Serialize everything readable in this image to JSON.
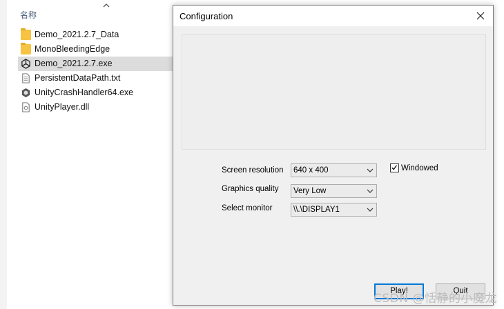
{
  "explorer": {
    "column_header": "名称",
    "files": [
      {
        "name": "Demo_2021.2.7_Data",
        "icon": "folder-icon"
      },
      {
        "name": "MonoBleedingEdge",
        "icon": "folder-icon"
      },
      {
        "name": "Demo_2021.2.7.exe",
        "icon": "unity-icon",
        "selected": true
      },
      {
        "name": "PersistentDataPath.txt",
        "icon": "text-file-icon"
      },
      {
        "name": "UnityCrashHandler64.exe",
        "icon": "crash-handler-icon"
      },
      {
        "name": "UnityPlayer.dll",
        "icon": "dll-file-icon"
      }
    ]
  },
  "dialog": {
    "title": "Configuration",
    "screen_resolution": {
      "label": "Screen resolution",
      "value": "640 x 400"
    },
    "graphics_quality": {
      "label": "Graphics quality",
      "value": "Very Low"
    },
    "select_monitor": {
      "label": "Select monitor",
      "value": "\\\\.\\DISPLAY1"
    },
    "windowed": {
      "label": "Windowed",
      "checked": true
    },
    "play_label": "Play!",
    "quit_label": "Quit"
  },
  "watermark": "CSDN @恬静的小魔龙",
  "colors": {
    "accent": "#0078d7",
    "selection": "#dcdcdc",
    "folder": "#f6c342"
  }
}
